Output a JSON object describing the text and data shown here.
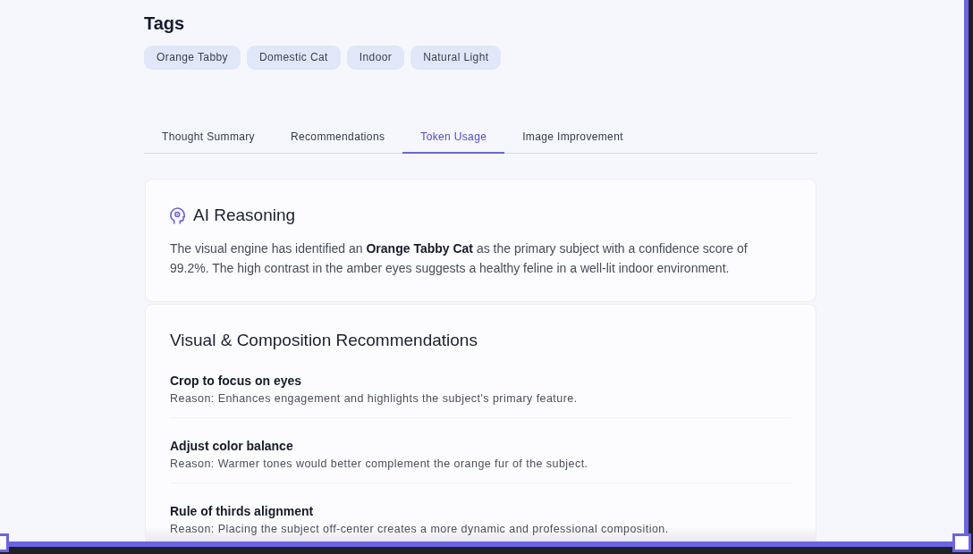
{
  "tags": {
    "title": "Tags",
    "items": [
      "Orange Tabby",
      "Domestic Cat",
      "Indoor",
      "Natural Light"
    ]
  },
  "tabs": [
    {
      "label": "Thought Summary",
      "selected": false
    },
    {
      "label": "Recommendations",
      "selected": false
    },
    {
      "label": "Token Usage",
      "selected": true
    },
    {
      "label": "Image Improvement",
      "selected": false
    }
  ],
  "reasoning_card": {
    "title": "AI Reasoning",
    "text": "The visual engine has identified an **Orange Tabby Cat** as the primary subject with a confidence score of 99.2%. The high contrast in the amber eyes suggests a healthy feline in a well-lit indoor environment."
  },
  "recommendations_card": {
    "title": "Visual & Composition Recommendations",
    "items": [
      {
        "title": "Crop to focus on eyes",
        "reason": "Reason: Enhances engagement and highlights the subject's primary feature."
      },
      {
        "title": "Adjust color balance",
        "reason": "Reason: Warmer tones would better complement the orange fur of the subject."
      },
      {
        "title": "Rule of thirds alignment",
        "reason": "Reason: Placing the subject off-center creates a more dynamic and professional composition."
      }
    ]
  }
}
